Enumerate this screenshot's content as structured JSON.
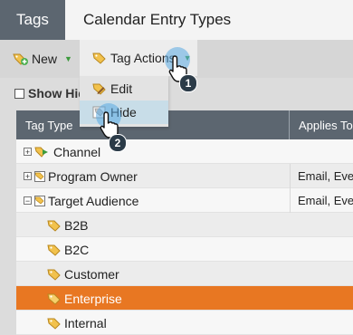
{
  "tabs": {
    "tags": "Tags",
    "calendar": "Calendar Entry Types"
  },
  "toolbar": {
    "new_label": "New",
    "show_hidden_label": "Show Hid"
  },
  "tag_actions": {
    "label": "Tag Actions",
    "items": [
      {
        "label": "Edit"
      },
      {
        "label": "Hide"
      }
    ]
  },
  "callouts": {
    "first": "1",
    "second": "2"
  },
  "table": {
    "headers": {
      "tag_type": "Tag Type",
      "applies_to": "Applies To"
    },
    "rows": [
      {
        "label": "Channel",
        "applies": ""
      },
      {
        "label": "Program Owner",
        "applies": "Email, Eve"
      },
      {
        "label": "Target Audience",
        "applies": "Email, Eve"
      },
      {
        "label": "B2B",
        "applies": ""
      },
      {
        "label": "B2C",
        "applies": ""
      },
      {
        "label": "Customer",
        "applies": ""
      },
      {
        "label": "Enterprise",
        "applies": ""
      },
      {
        "label": "Internal",
        "applies": ""
      }
    ]
  },
  "colors": {
    "header": "#5c6670",
    "selected": "#e87722",
    "menu_hover": "#c8dde8"
  }
}
